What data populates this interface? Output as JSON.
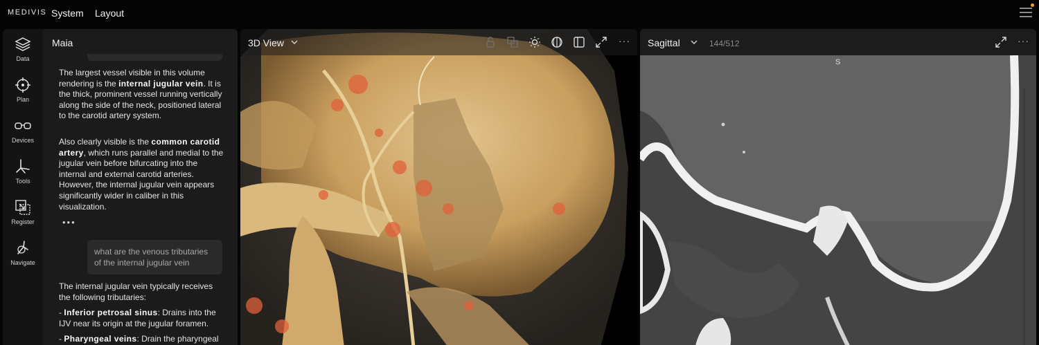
{
  "app": {
    "brand": "MEDIVIS",
    "menu": [
      "System",
      "Layout"
    ]
  },
  "rail": {
    "items": [
      {
        "label": "Data",
        "icon": "layers-icon"
      },
      {
        "label": "Plan",
        "icon": "crosshair-icon"
      },
      {
        "label": "Devices",
        "icon": "glasses-icon"
      },
      {
        "label": "Tools",
        "icon": "tools-icon"
      },
      {
        "label": "Register",
        "icon": "register-icon"
      },
      {
        "label": "Navigate",
        "icon": "navigate-icon"
      }
    ]
  },
  "chat": {
    "title": "Maia",
    "answer1": {
      "p1_pre": "The largest vessel visible in this volume rendering is the ",
      "p1_bold": "internal jugular vein",
      "p1_post": ". It is the thick, prominent vessel running vertically along the side of the neck, positioned lateral to the carotid artery system.",
      "p2_pre": "Also clearly visible is the ",
      "p2_bold": "common carotid artery",
      "p2_post": ", which runs parallel and medial to the jugular vein before bifurcating into the internal and external carotid arteries. However, the internal jugular vein appears significantly wider in caliber in this visualization."
    },
    "ellipsis": "•••",
    "user_question": "what are the venous tributaries of the internal jugular vein",
    "answer2": {
      "intro": "The internal jugular vein typically receives the following tributaries:",
      "b1_bold": "Inferior petrosal sinus",
      "b1_post": ": Drains into the IJV near its origin at the jugular foramen.",
      "b2_bold": "Pharyngeal veins",
      "b2_post": ": Drain the pharyngeal"
    }
  },
  "view3d": {
    "title": "3D View",
    "more": "···"
  },
  "sagittal": {
    "title": "Sagittal",
    "slice": "144/512",
    "orientation": "S",
    "more": "···"
  },
  "colors": {
    "accent_dot": "#f0a030",
    "panel_bg": "#1b1b1b",
    "bone": "#d8b47a",
    "vessel": "#e0603a"
  }
}
